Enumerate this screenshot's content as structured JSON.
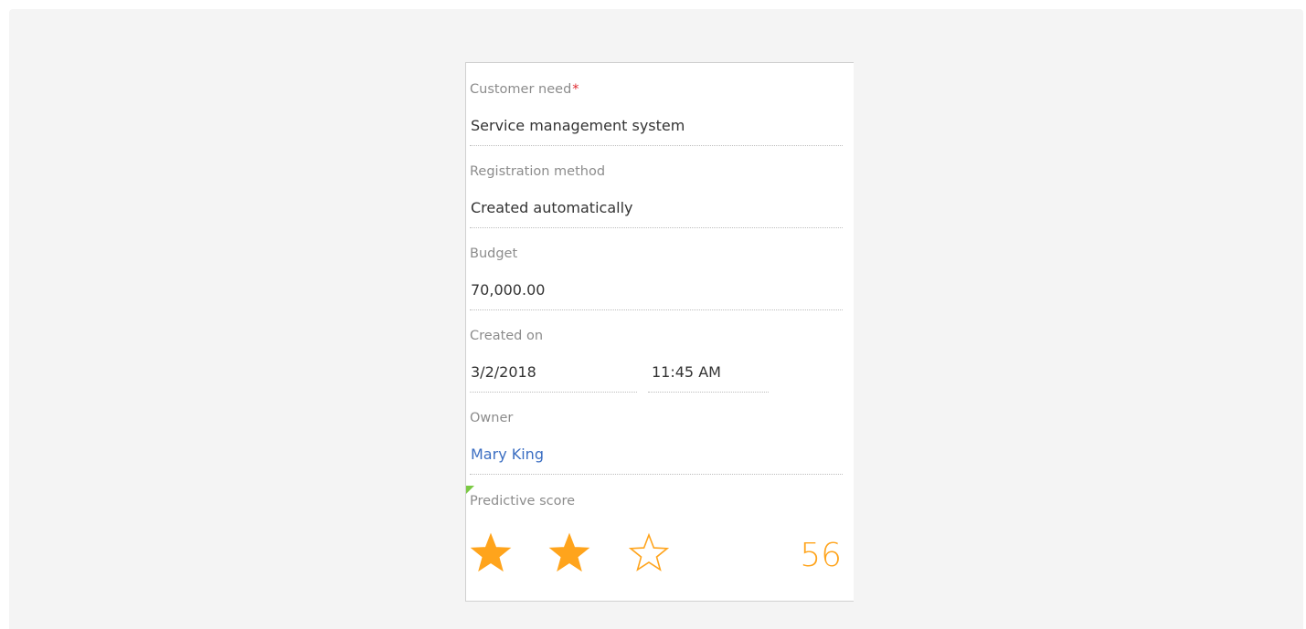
{
  "fields": {
    "customer_need": {
      "label": "Customer need",
      "required_mark": "*",
      "value": "Service management system"
    },
    "registration_method": {
      "label": "Registration method",
      "value": "Created automatically"
    },
    "budget": {
      "label": "Budget",
      "value": "70,000.00"
    },
    "created_on": {
      "label": "Created on",
      "date": "3/2/2018",
      "time": "11:45 AM"
    },
    "owner": {
      "label": "Owner",
      "value": "Mary King"
    },
    "predictive_score": {
      "label": "Predictive score",
      "stars_filled": 2,
      "stars_total": 3,
      "value": "56"
    }
  },
  "colors": {
    "star": "#ffa41c",
    "link": "#3b6ec2",
    "required": "#e0282e",
    "marker": "#7ac943"
  }
}
